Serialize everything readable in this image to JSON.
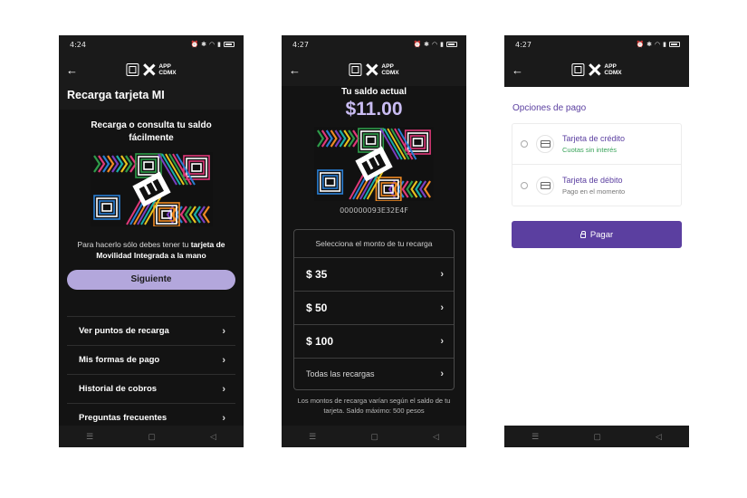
{
  "colors": {
    "dark_bg": "#1a1a1a",
    "accent_purple": "#5b3fa0",
    "button_lavender": "#b3a7dc",
    "balance_lavender": "#c9bcf2",
    "success_green": "#3aa35a"
  },
  "logo": {
    "line1": "APP",
    "line2": "CDMX"
  },
  "screen1": {
    "time": "4:24",
    "title": "Recarga tarjeta MI",
    "heading": "Recarga o consulta tu saldo fácilmente",
    "desc_plain": "Para hacerlo sólo debes tener tu ",
    "desc_bold": "tarjeta de Movilidad Integrada a la mano",
    "next_button": "Siguiente",
    "menu": [
      {
        "label": "Ver puntos de recarga"
      },
      {
        "label": "Mis formas de pago"
      },
      {
        "label": "Historial de cobros"
      },
      {
        "label": "Preguntas frecuentes"
      }
    ]
  },
  "screen2": {
    "time": "4:27",
    "balance_label": "Tu saldo actual",
    "balance_value": "$11.00",
    "card_number": "000000093E32E4F",
    "amount_prompt": "Selecciona el monto de tu recarga",
    "amounts": [
      {
        "label": "$ 35"
      },
      {
        "label": "$ 50"
      },
      {
        "label": "$ 100"
      }
    ],
    "all_recharges": "Todas las recargas",
    "note": "Los montos de recarga varían según el saldo de tu tarjeta. Saldo máximo: 500 pesos"
  },
  "screen3": {
    "time": "4:27",
    "options_title": "Opciones de pago",
    "options": [
      {
        "name": "Tarjeta de crédito",
        "sub": "Cuotas sin interés"
      },
      {
        "name": "Tarjeta de débito",
        "sub": "Pago en el momento"
      }
    ],
    "pay_button": "Pagar"
  },
  "nav_icons": [
    "menu-icon",
    "home-icon",
    "back-triangle-icon"
  ]
}
